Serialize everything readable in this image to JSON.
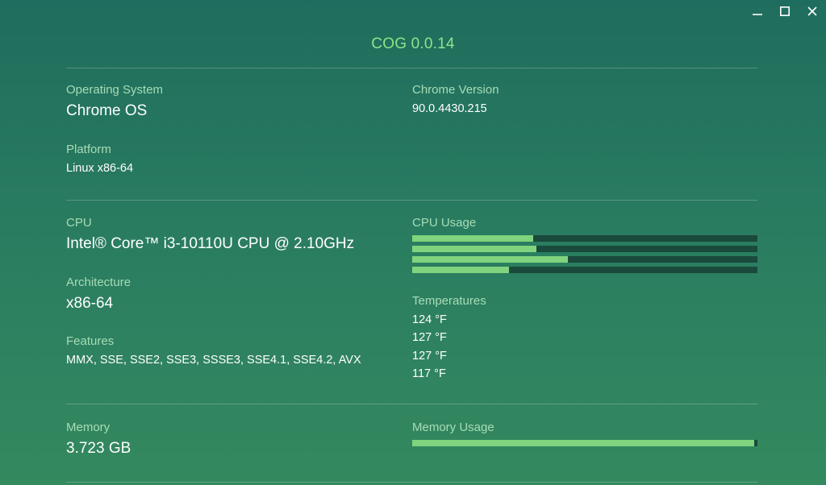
{
  "app": {
    "title": "COG 0.0.14"
  },
  "window": {
    "minimize_icon": "minimize-icon",
    "maximize_icon": "maximize-icon",
    "close_icon": "close-icon"
  },
  "system": {
    "os_label": "Operating System",
    "os_value": "Chrome OS",
    "platform_label": "Platform",
    "platform_value": "Linux x86-64",
    "chrome_label": "Chrome Version",
    "chrome_value": "90.0.4430.215"
  },
  "cpu": {
    "cpu_label": "CPU",
    "cpu_value": "Intel® Core™ i3-10110U CPU @ 2.10GHz",
    "arch_label": "Architecture",
    "arch_value": "x86-64",
    "features_label": "Features",
    "features_value": "MMX, SSE, SSE2, SSE3, SSSE3, SSE4.1, SSE4.2, AVX",
    "usage_label": "CPU Usage",
    "usage": [
      35,
      36,
      45,
      28
    ],
    "temps_label": "Temperatures",
    "temps": [
      "124 °F",
      "127 °F",
      "127 °F",
      "117 °F"
    ]
  },
  "memory": {
    "label": "Memory",
    "value": "3.723 GB",
    "usage_label": "Memory Usage",
    "usage": 99
  },
  "colors": {
    "accent": "#8ee38b",
    "bar_fill": "#7fd47d",
    "bar_track": "#1a4a3c",
    "label": "#a7dcb6"
  }
}
